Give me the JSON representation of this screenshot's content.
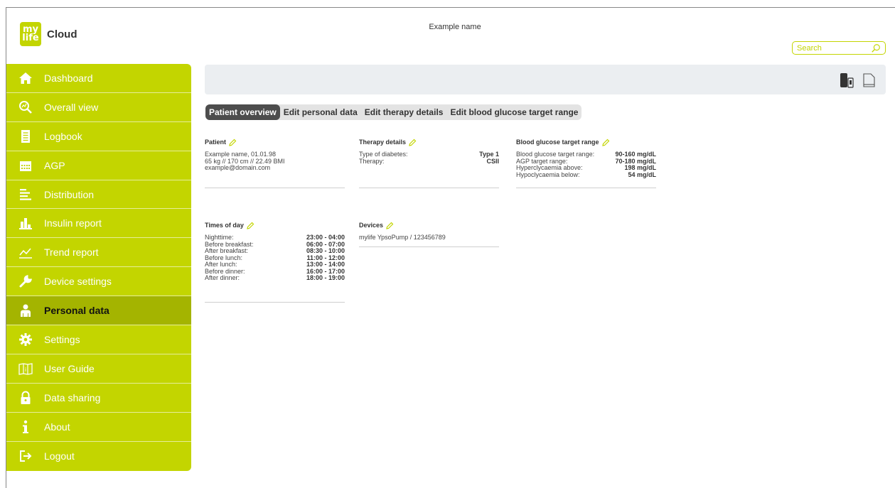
{
  "app": {
    "logo_top": "my",
    "logo_bottom": "life",
    "logo_text": "Cloud"
  },
  "header": {
    "username": "Example name"
  },
  "search": {
    "placeholder": "Search"
  },
  "sidebar": {
    "items": [
      {
        "label": "Dashboard",
        "icon": "home-icon"
      },
      {
        "label": "Overall view",
        "icon": "overall-view-icon"
      },
      {
        "label": "Logbook",
        "icon": "logbook-icon"
      },
      {
        "label": "AGP",
        "icon": "calendar-icon"
      },
      {
        "label": "Distribution",
        "icon": "distribution-icon"
      },
      {
        "label": "Insulin report",
        "icon": "bar-chart-icon"
      },
      {
        "label": "Trend report",
        "icon": "trend-icon"
      },
      {
        "label": "Device settings",
        "icon": "wrench-icon"
      },
      {
        "label": "Personal data",
        "icon": "person-icon",
        "active": true
      },
      {
        "label": "Settings",
        "icon": "gear-icon"
      },
      {
        "label": "User Guide",
        "icon": "book-icon"
      },
      {
        "label": "Data sharing",
        "icon": "lock-icon"
      },
      {
        "label": "About",
        "icon": "info-icon"
      },
      {
        "label": "Logout",
        "icon": "logout-icon"
      }
    ]
  },
  "tabs": [
    {
      "label": "Patient overview",
      "active": true
    },
    {
      "label": "Edit personal data"
    },
    {
      "label": "Edit therapy details"
    },
    {
      "label": "Edit blood glucose target range"
    }
  ],
  "patient": {
    "title": "Patient",
    "line1": "Example name, 01.01.98",
    "line2": "65 kg // 170 cm // 22.49 BMI",
    "line3": "example@domain.com"
  },
  "therapy": {
    "title": "Therapy details",
    "rows": [
      {
        "label": "Type of diabetes:",
        "value": "Type 1"
      },
      {
        "label": "Therapy:",
        "value": "CSII"
      }
    ]
  },
  "bg_target": {
    "title": "Blood glucose target range",
    "rows": [
      {
        "label": "Blood glucose target range:",
        "value": "90-160 mg/dL"
      },
      {
        "label": "AGP target range:",
        "value": "70-180 mg/dL"
      },
      {
        "label": "Hyperclycaemia above:",
        "value": "198 mg/dL"
      },
      {
        "label": "Hypoclycaemia below:",
        "value": "54 mg/dL"
      }
    ]
  },
  "times": {
    "title": "Times of day",
    "rows": [
      {
        "label": "Nighttime:",
        "value": "23:00 - 04:00"
      },
      {
        "label": "Before breakfast:",
        "value": "06:00 - 07:00"
      },
      {
        "label": "After breakfast:",
        "value": "08:30 - 10:00"
      },
      {
        "label": "Before lunch:",
        "value": "11:00 - 12:00"
      },
      {
        "label": "After lunch:",
        "value": "13:00 - 14:00"
      },
      {
        "label": "Before dinner:",
        "value": "16:00 - 17:00"
      },
      {
        "label": "After dinner:",
        "value": "18:00 - 19:00"
      }
    ]
  },
  "devices": {
    "title": "Devices",
    "line1": "mylife YpsoPump / 123456789"
  },
  "colors": {
    "accent": "#c3d500",
    "accent_dark": "#a4b400",
    "toolbar_bg": "#ebeef1"
  }
}
